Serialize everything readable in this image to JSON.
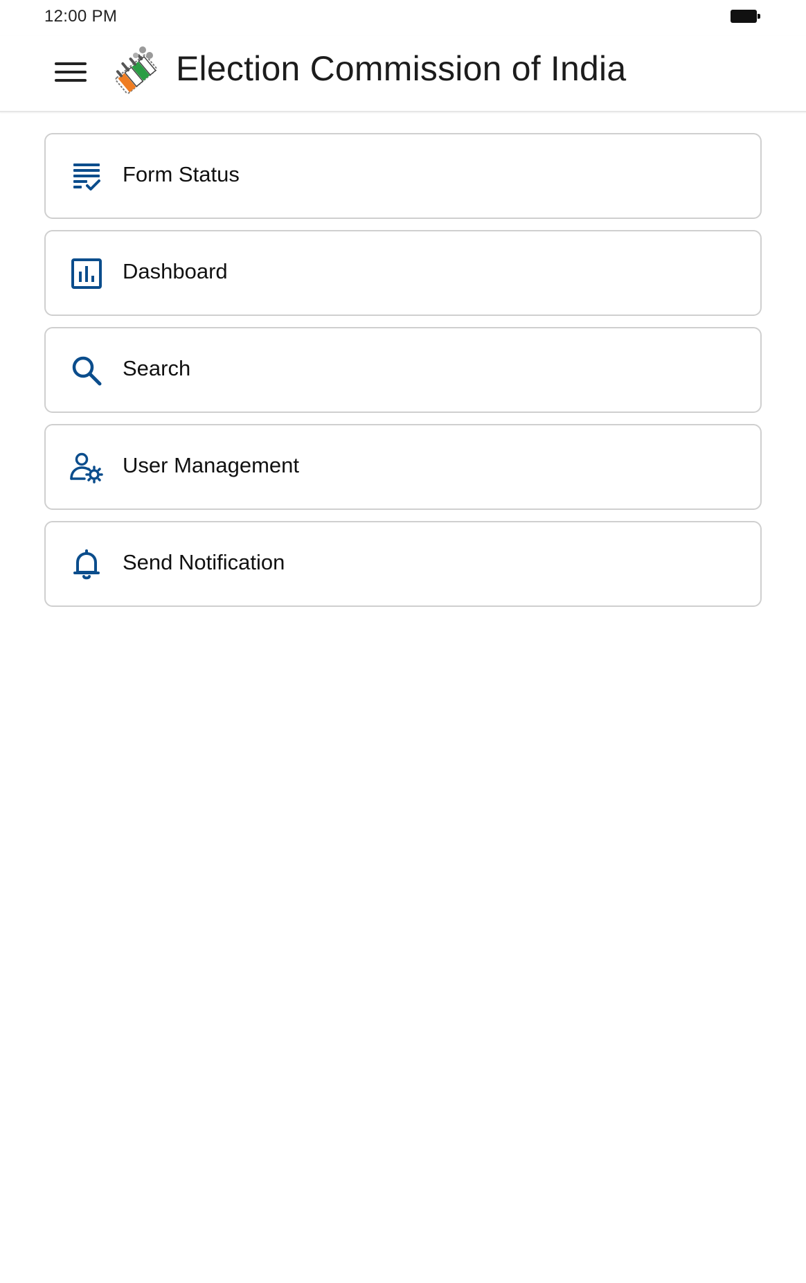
{
  "status_bar": {
    "time": "12:00 PM",
    "battery_icon": "battery-full-icon"
  },
  "app_bar": {
    "title": "Election Commission of India",
    "menu_icon": "hamburger-menu-icon",
    "logo": "eci-logo",
    "logo_colors": [
      "#ef7d22",
      "#2a9d44",
      "#7a7a7a"
    ]
  },
  "accent_color": "#0b4d8c",
  "menu": {
    "items": [
      {
        "label": "Form Status",
        "icon": "form-status-icon"
      },
      {
        "label": "Dashboard",
        "icon": "dashboard-icon"
      },
      {
        "label": "Search",
        "icon": "search-icon"
      },
      {
        "label": "User Management",
        "icon": "user-settings-icon"
      },
      {
        "label": "Send Notification",
        "icon": "bell-icon"
      }
    ]
  }
}
